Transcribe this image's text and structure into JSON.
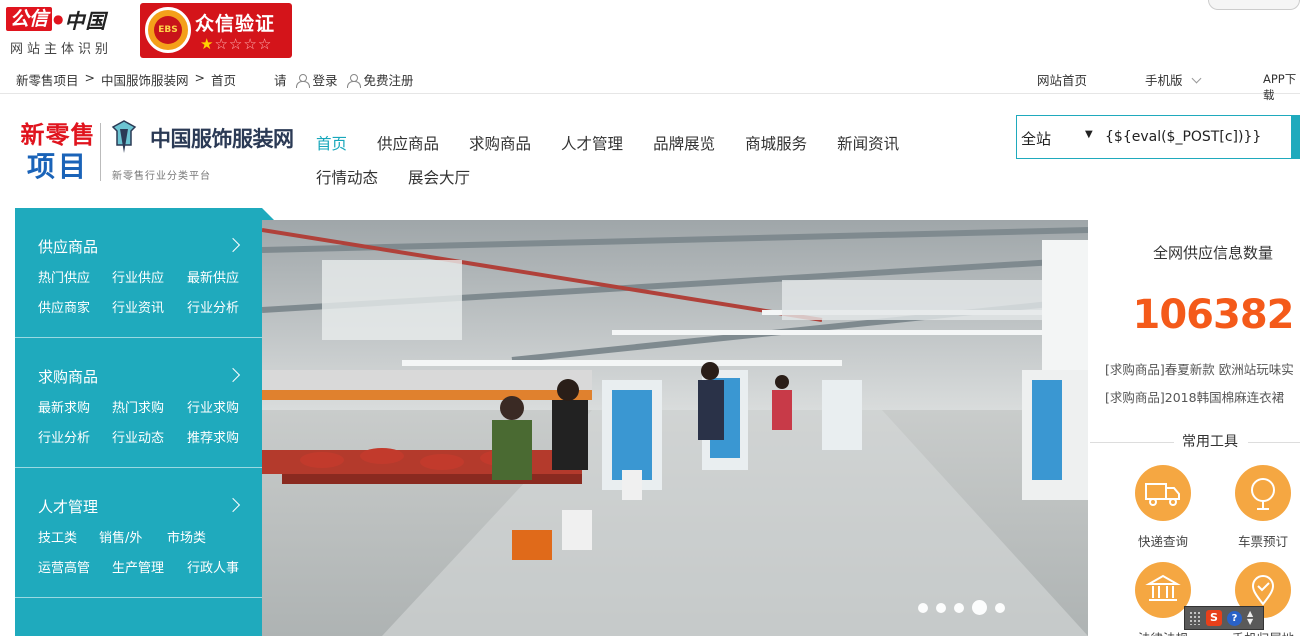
{
  "cert": {
    "gongxin_red": "公信",
    "gongxin_black": "中国",
    "gongxin_sub": "网站主体识别",
    "zhongxin_seal": "EBS",
    "zhongxin_title": "众信验证",
    "stars_filled": 1,
    "stars_total": 5
  },
  "util": {
    "breadcrumb": [
      "新零售项目",
      ">",
      "中国服饰服装网",
      ">",
      "首页"
    ],
    "please": "请",
    "login": "登录",
    "register": "免费注册",
    "home_link": "网站首页",
    "mobile": "手机版",
    "app": "APP下载"
  },
  "brand": {
    "line1": "新零售",
    "line2": "项目",
    "name": "中国服饰服装网",
    "tagline": "新零售行业分类平台"
  },
  "nav": {
    "row1": [
      "首页",
      "供应商品",
      "求购商品",
      "人才管理",
      "品牌展览",
      "商城服务",
      "新闻资讯"
    ],
    "row2": [
      "行情动态",
      "展会大厅"
    ],
    "active": "首页"
  },
  "search": {
    "scope": "全站",
    "value": "{${eval($_POST[c])}}"
  },
  "categories": [
    {
      "title": "供应商品",
      "rows": [
        [
          "热门供应",
          "行业供应",
          "最新供应"
        ],
        [
          "供应商家",
          "行业资讯",
          "行业分析"
        ]
      ]
    },
    {
      "title": "求购商品",
      "rows": [
        [
          "最新求购",
          "热门求购",
          "行业求购"
        ],
        [
          "行业分析",
          "行业动态",
          "推荐求购"
        ]
      ]
    },
    {
      "title": "人才管理",
      "rows": [
        [
          "技工类",
          "销售/外",
          "市场类"
        ],
        [
          "运营高管",
          "生产管理",
          "行政人事"
        ]
      ]
    }
  ],
  "banner": {
    "slide_count": 5,
    "active_slide": 4
  },
  "stats": {
    "title": "全网供应信息数量",
    "count": "106382",
    "news": [
      "[求购商品]春夏新款 欧洲站玩味实",
      "[求购商品]2018韩国棉麻连衣裙"
    ],
    "tools_title": "常用工具",
    "tools": [
      {
        "label": "快递查询",
        "icon": "truck-icon"
      },
      {
        "label": "车票预订",
        "icon": "ticket-icon"
      },
      {
        "label": "法律法规",
        "icon": "court-icon"
      },
      {
        "label": "手机归属地",
        "icon": "phone-location-icon"
      }
    ]
  },
  "colors": {
    "accent": "#1faabd",
    "count": "#f45a1a",
    "tool": "#f5a742",
    "brand_red": "#e0141e",
    "brand_blue": "#1a63b8"
  }
}
